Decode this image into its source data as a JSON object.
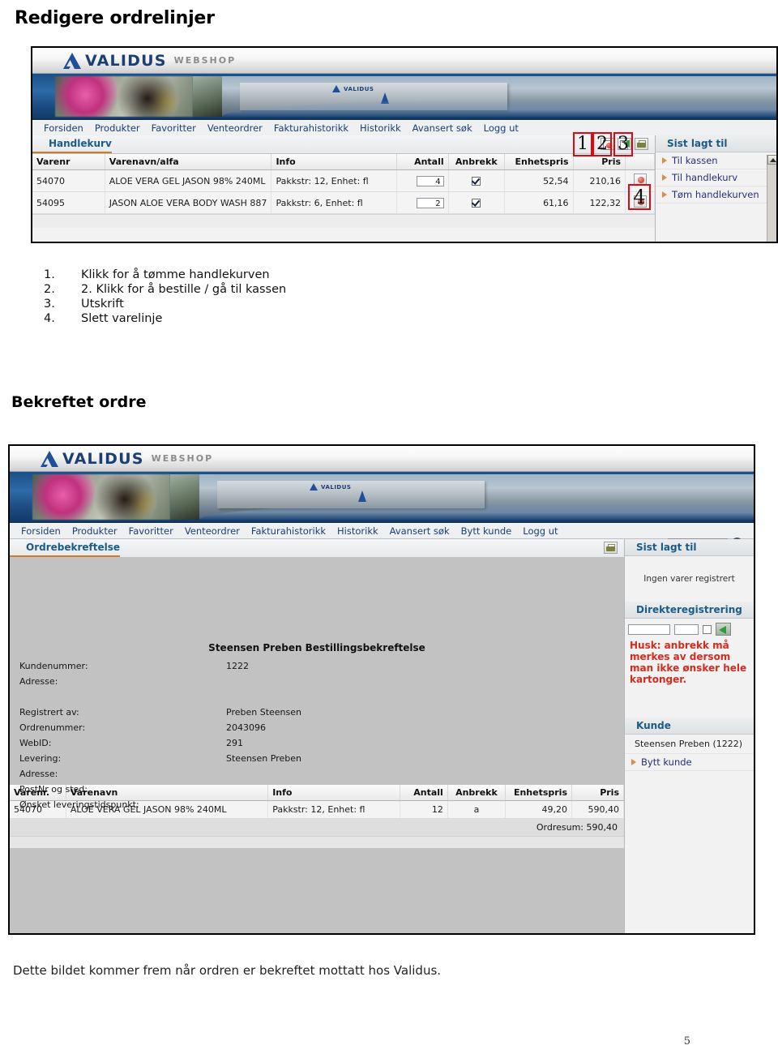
{
  "document": {
    "title": "Redigere ordrelinjer",
    "section_title": "Bekreftet ordre",
    "caption": "Dette bildet kommer frem når ordren er bekreftet mottatt hos Validus.",
    "page_number": "5"
  },
  "brand": {
    "logo_word": "VALIDUS",
    "logo_sub": "WEBSHOP",
    "accent_blue": "#1b3f74",
    "link_blue": "#28307a",
    "heading_blue": "#1b5b88",
    "warn_red": "#d52b1e",
    "callout_red": "#e20613"
  },
  "steps": [
    {
      "num": "1.",
      "text": "Klikk for å tømme handlekurven"
    },
    {
      "num": "2.",
      "text": "2. Klikk for å bestille / gå til kassen"
    },
    {
      "num": "3.",
      "text": "Utskrift"
    },
    {
      "num": "4.",
      "text": "Slett varelinje"
    }
  ],
  "callouts": {
    "one": "1",
    "two": "2",
    "three": "3",
    "four": "4"
  },
  "shot_cart": {
    "nav": [
      "Forsiden",
      "Produkter",
      "Favoritter",
      "Venteordrer",
      "Fakturahistorikk",
      "Historikk",
      "Avansert søk",
      "Logg ut"
    ],
    "page_title": "Handlekurv",
    "search": {
      "value": "",
      "placeholder": ""
    },
    "toolbar": [
      {
        "name": "empty-cart-icon",
        "label": "Tøm handlekurv"
      },
      {
        "name": "checkout-icon",
        "label": "Til kassen"
      },
      {
        "name": "print-icon",
        "label": "Utskrift"
      }
    ],
    "table": {
      "headers": [
        "Varenr",
        "Varenavn/alfa",
        "Info",
        "Antall",
        "Anbrekk",
        "Enhetspris",
        "Pris",
        ""
      ],
      "rows": [
        {
          "varenr": "54070",
          "varenavn": "ALOE VERA GEL JASON 98% 240ML",
          "info": "Pakkstr: 12, Enhet: fl",
          "antall": "4",
          "anbrekk": true,
          "enhetspris": "52,54",
          "pris": "210,16"
        },
        {
          "varenr": "54095",
          "varenavn": "JASON ALOE VERA BODY WASH 887",
          "info": "Pakkstr: 6, Enhet: fl",
          "antall": "2",
          "anbrekk": true,
          "enhetspris": "61,16",
          "pris": "122,32"
        }
      ]
    },
    "sidebar": {
      "heading": "Sist lagt til",
      "links": [
        "Til kassen",
        "Til handlekurv",
        "Tøm handlekurven"
      ]
    }
  },
  "shot_confirm": {
    "nav": [
      "Forsiden",
      "Produkter",
      "Favoritter",
      "Venteordrer",
      "Fakturahistorikk",
      "Historikk",
      "Avansert søk",
      "Bytt kunde",
      "Logg ut"
    ],
    "page_title": "Ordrebekreftelse",
    "search": {
      "value": "",
      "placeholder": ""
    },
    "toolbar": [
      {
        "name": "print-icon",
        "label": "Utskrift"
      }
    ],
    "confirmation": {
      "title": "Steensen Preben Bestillingsbekreftelse",
      "fields": [
        {
          "label": "Kundenummer:",
          "value": "1222"
        },
        {
          "label": "Adresse:",
          "value": ""
        },
        {
          "label": "",
          "value": ""
        },
        {
          "label": "Registrert av:",
          "value": "Preben Steensen"
        },
        {
          "label": "Ordrenummer:",
          "value": "2043096"
        },
        {
          "label": "WebID:",
          "value": "291"
        },
        {
          "label": "Levering:",
          "value": "Steensen Preben"
        },
        {
          "label": "Adresse:",
          "value": ""
        },
        {
          "label": "PostNr og sted:",
          "value": ""
        },
        {
          "label": "Ønsket leveringstidspunkt:",
          "value": ""
        }
      ]
    },
    "table": {
      "headers": [
        "Varenr.",
        "Varenavn",
        "Info",
        "Antall",
        "Anbrekk",
        "Enhetspris",
        "Pris"
      ],
      "rows": [
        {
          "varenr": "54070",
          "varenavn": "ALOE VERA GEL JASON 98% 240ML",
          "info": "Pakkstr: 12, Enhet: fl",
          "antall": "12",
          "anbrekk": "a",
          "enhetspris": "49,20",
          "pris": "590,40"
        }
      ],
      "summary": "Ordresum: 590,40"
    },
    "sidebar": {
      "last_added_heading": "Sist lagt til",
      "last_added_empty": "Ingen varer registrert",
      "direct_heading": "Direkteregistrering",
      "direct_input1": "",
      "direct_input2": "",
      "warning": "Husk: anbrekk må merkes av dersom man ikke ønsker hele kartonger.",
      "customer_heading": "Kunde",
      "customer_name": "Steensen Preben (1222)",
      "change_customer_link": "Bytt kunde"
    }
  }
}
